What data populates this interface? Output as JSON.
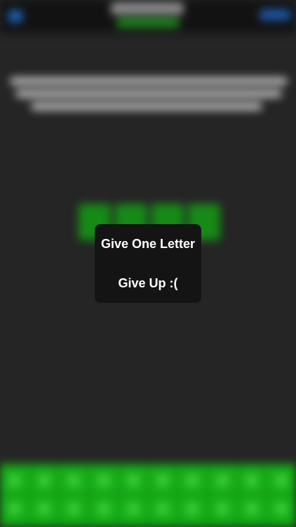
{
  "menu": {
    "give_one_letter": "Give One Letter",
    "give_up": "Give Up :("
  },
  "colors": {
    "background": "#252525",
    "accent_green": "#16a016",
    "accent_blue": "#1d5fb0",
    "popup_bg": "#141414",
    "popup_text": "#ffffff"
  },
  "icons": {
    "back": "chevron-left-icon"
  }
}
